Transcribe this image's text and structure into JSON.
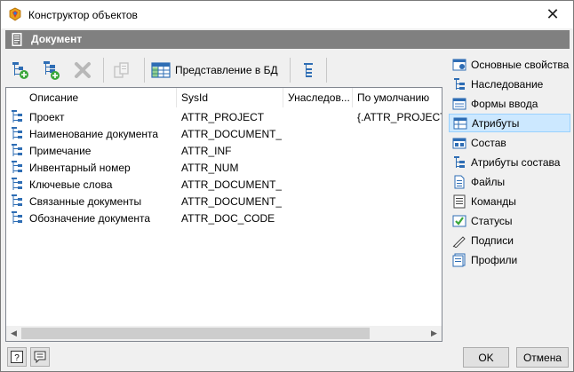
{
  "window": {
    "title": "Конструктор объектов",
    "close_glyph": "✕"
  },
  "section": {
    "title": "Документ"
  },
  "toolbar": {
    "add_attribute_icon": "add-attribute-icon",
    "add_child_icon": "add-child-icon",
    "delete_icon": "delete-icon",
    "copy_icon": "copy-icon",
    "db_view_label": "Представление в БД",
    "tree_view_icon": "tree-view-icon"
  },
  "grid": {
    "columns": [
      "Описание",
      "SysId",
      "Унаследов...",
      "По умолчанию"
    ],
    "rows": [
      {
        "description": "Проект",
        "sysid": "ATTR_PROJECT",
        "inherited": "",
        "default": "{.ATTR_PROJECT}"
      },
      {
        "description": "Наименование документа",
        "sysid": "ATTR_DOCUMENT_...",
        "inherited": "",
        "default": ""
      },
      {
        "description": "Примечание",
        "sysid": "ATTR_INF",
        "inherited": "",
        "default": ""
      },
      {
        "description": "Инвентарный номер",
        "sysid": "ATTR_NUM",
        "inherited": "",
        "default": ""
      },
      {
        "description": "Ключевые слова",
        "sysid": "ATTR_DOCUMENT_...",
        "inherited": "",
        "default": ""
      },
      {
        "description": "Связанные документы",
        "sysid": "ATTR_DOCUMENT_...",
        "inherited": "",
        "default": ""
      },
      {
        "description": "Обозначение документа",
        "sysid": "ATTR_DOC_CODE",
        "inherited": "",
        "default": ""
      }
    ]
  },
  "nav": {
    "items": [
      {
        "label": "Основные свойства",
        "icon": "properties-icon"
      },
      {
        "label": "Наследование",
        "icon": "inheritance-icon"
      },
      {
        "label": "Формы ввода",
        "icon": "forms-icon"
      },
      {
        "label": "Атрибуты",
        "icon": "attributes-icon",
        "selected": true
      },
      {
        "label": "Состав",
        "icon": "composition-icon"
      },
      {
        "label": "Атрибуты состава",
        "icon": "composition-attributes-icon"
      },
      {
        "label": "Файлы",
        "icon": "files-icon"
      },
      {
        "label": "Команды",
        "icon": "commands-icon"
      },
      {
        "label": "Статусы",
        "icon": "statuses-icon"
      },
      {
        "label": "Подписи",
        "icon": "signatures-icon"
      },
      {
        "label": "Профили",
        "icon": "profiles-icon"
      }
    ]
  },
  "footer": {
    "help_glyph": "?",
    "ok_label": "OK",
    "cancel_label": "Отмена"
  },
  "colors": {
    "header_bg": "#808080",
    "selection_bg": "#cce8ff",
    "icon_blue": "#2e6db4",
    "icon_green": "#3aa63a"
  }
}
